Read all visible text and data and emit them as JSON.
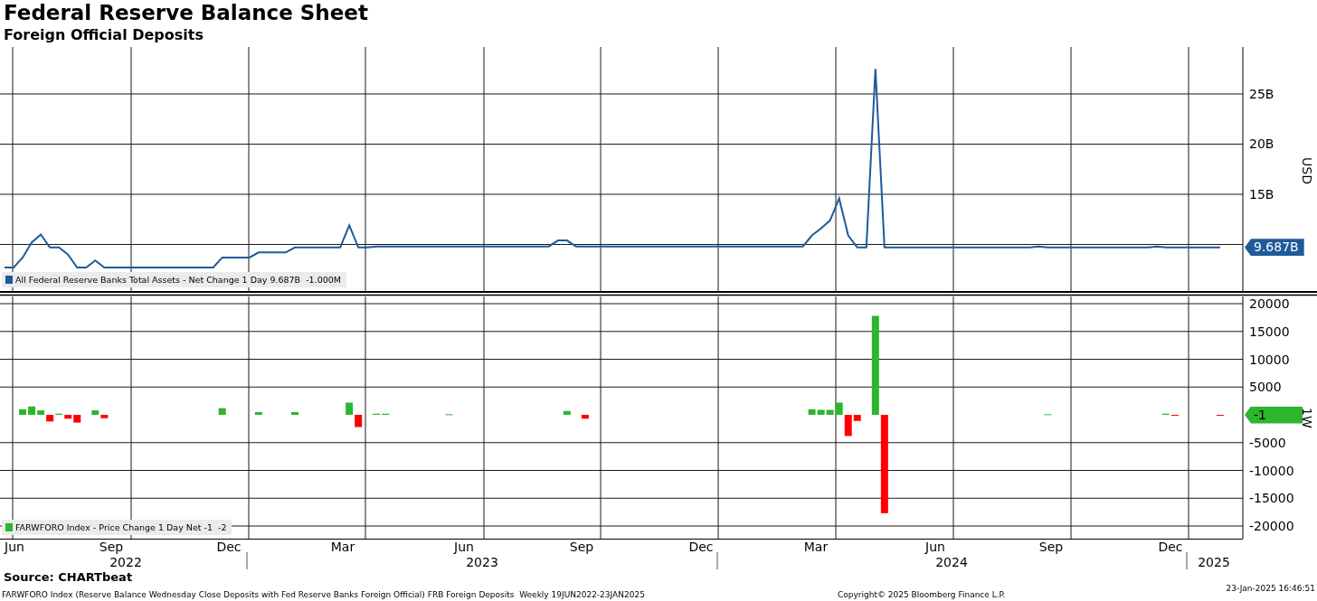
{
  "title": "Federal Reserve Balance Sheet",
  "subtitle": "Foreign Official Deposits",
  "charts": [
    {
      "chart_data": {
        "type": "line",
        "ylabel": "USD",
        "grid": true,
        "ylim": [
          5.36,
          29.68
        ],
        "yticks": [
          {
            "value": 15,
            "label": "15B"
          },
          {
            "value": 20,
            "label": "20B"
          },
          {
            "value": 25,
            "label": "25B"
          }
        ],
        "series": [
          {
            "name": "All Federal Reserve Banks Total Assets - Net Change 1 Day",
            "color": "#1f5a9a",
            "values": [
              7.7,
              7.7,
              8.7,
              10.2,
              11.0,
              9.7,
              9.7,
              9.0,
              7.7,
              7.7,
              8.4,
              7.7,
              7.7,
              7.7,
              7.7,
              7.7,
              7.7,
              7.7,
              7.7,
              7.7,
              7.7,
              7.7,
              7.7,
              7.7,
              8.7,
              8.7,
              8.7,
              8.7,
              9.2,
              9.2,
              9.2,
              9.2,
              9.7,
              9.7,
              9.7,
              9.7,
              9.7,
              9.7,
              11.9,
              9.7,
              9.7,
              9.8,
              9.8,
              9.8,
              9.8,
              9.8,
              9.8,
              9.8,
              9.8,
              9.8,
              9.8,
              9.8,
              9.8,
              9.8,
              9.8,
              9.8,
              9.8,
              9.8,
              9.8,
              9.8,
              9.8,
              10.4,
              10.4,
              9.8,
              9.8,
              9.8,
              9.8,
              9.8,
              9.8,
              9.8,
              9.8,
              9.8,
              9.8,
              9.8,
              9.8,
              9.8,
              9.8,
              9.8,
              9.8,
              9.8,
              9.8,
              9.8,
              9.8,
              9.8,
              9.8,
              9.8,
              9.8,
              9.8,
              9.8,
              10.9,
              11.6,
              12.4,
              14.6,
              10.9,
              9.7,
              9.7,
              27.5,
              9.7,
              9.7,
              9.7,
              9.7,
              9.7,
              9.7,
              9.7,
              9.7,
              9.7,
              9.7,
              9.7,
              9.7,
              9.7,
              9.7,
              9.7,
              9.7,
              9.7,
              9.8,
              9.7,
              9.7,
              9.7,
              9.7,
              9.7,
              9.7,
              9.7,
              9.7,
              9.7,
              9.7,
              9.7,
              9.7,
              9.8,
              9.7,
              9.7,
              9.7,
              9.7,
              9.7,
              9.7,
              9.7,
              null,
              null
            ]
          }
        ]
      },
      "legend_values": "9.687B  -1.000M",
      "last_value": "9.687B"
    },
    {
      "chart_data": {
        "type": "bar",
        "grid": true,
        "ylim": [
          -22276,
          21301
        ],
        "yticks": [
          -20000,
          -15000,
          -10000,
          -5000,
          5000,
          10000,
          15000,
          20000
        ],
        "series": [
          {
            "name": "FARWFORO Index - Price Change 1 Day Net",
            "color": "#2db52d",
            "values": [
              0,
              0,
              1000,
              1500,
              800,
              null,
              200,
              null,
              null,
              0,
              800,
              null,
              0,
              0,
              0,
              0,
              0,
              0,
              0,
              0,
              0,
              0,
              0,
              0,
              1200,
              0,
              0,
              0,
              500,
              0,
              0,
              0,
              500,
              0,
              0,
              0,
              0,
              0,
              2200,
              null,
              0,
              200,
              200,
              0,
              0,
              0,
              0,
              0,
              0,
              100,
              0,
              0,
              0,
              0,
              0,
              0,
              0,
              0,
              0,
              0,
              0,
              0,
              700,
              0,
              null,
              0,
              0,
              0,
              0,
              0,
              0,
              0,
              0,
              0,
              0,
              0,
              0,
              0,
              0,
              0,
              0,
              0,
              0,
              0,
              0,
              0,
              0,
              0,
              0,
              1000,
              900,
              900,
              2200,
              null,
              null,
              0,
              17800,
              null,
              0,
              0,
              0,
              0,
              0,
              0,
              0,
              0,
              0,
              0,
              0,
              0,
              0,
              0,
              0,
              0,
              0,
              100,
              0,
              0,
              0,
              0,
              0,
              0,
              0,
              0,
              0,
              0,
              0,
              0,
              200,
              null,
              0,
              0,
              0,
              0,
              null,
              null,
              null
            ]
          },
          {
            "color": "#ff0000",
            "values": [
              null,
              null,
              null,
              null,
              null,
              -1200,
              null,
              -700,
              -1400,
              null,
              null,
              -600,
              null,
              null,
              null,
              null,
              null,
              null,
              null,
              null,
              null,
              null,
              null,
              null,
              null,
              null,
              null,
              null,
              null,
              null,
              null,
              null,
              null,
              null,
              null,
              null,
              null,
              null,
              null,
              -2200,
              null,
              null,
              null,
              null,
              null,
              null,
              null,
              null,
              null,
              null,
              null,
              null,
              null,
              null,
              null,
              null,
              null,
              null,
              null,
              null,
              null,
              null,
              null,
              null,
              -700,
              null,
              null,
              null,
              null,
              null,
              null,
              null,
              null,
              null,
              null,
              null,
              null,
              null,
              null,
              null,
              null,
              null,
              null,
              null,
              null,
              null,
              null,
              null,
              null,
              null,
              null,
              null,
              null,
              -3800,
              -1100,
              null,
              null,
              -17700,
              null,
              null,
              null,
              null,
              null,
              null,
              null,
              null,
              null,
              null,
              null,
              null,
              null,
              null,
              null,
              null,
              null,
              null,
              null,
              null,
              null,
              null,
              null,
              null,
              null,
              null,
              null,
              null,
              null,
              null,
              null,
              -100,
              null,
              null,
              null,
              null,
              -1,
              null,
              null
            ]
          }
        ]
      },
      "legend_values": "-1  -2",
      "last_value": "-1",
      "period": "1W"
    }
  ],
  "x_axis": {
    "months": [
      "Jun",
      "Sep",
      "Dec",
      "Mar",
      "Jun",
      "Sep",
      "Dec",
      "Mar",
      "Jun",
      "Sep",
      "Dec"
    ],
    "years": [
      "2022",
      "2023",
      "2024",
      "2025"
    ]
  },
  "source": "Source: CHARTbeat",
  "footnote": "FARWFORO Index (Reserve Balance Wednesday Close Deposits with Fed Reserve Banks Foreign Official) FRB Foreign Deposits  Weekly 19JUN2022-23JAN2025",
  "copyright": "Copyright© 2025 Bloomberg Finance L.P.",
  "timestamp": "23-Jan-2025 16:46:51"
}
